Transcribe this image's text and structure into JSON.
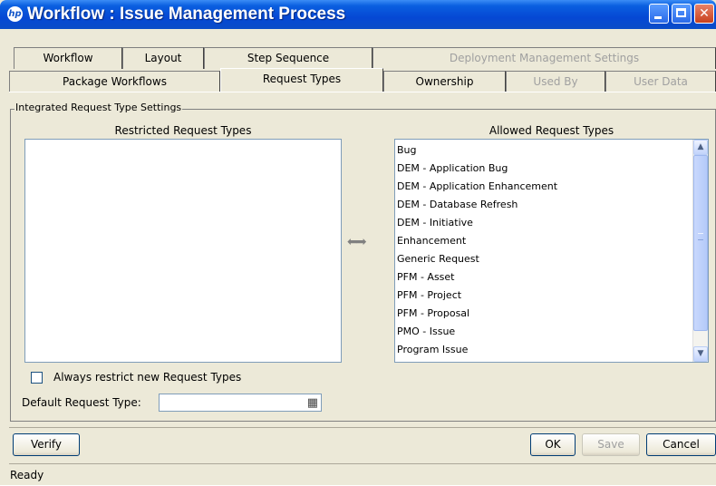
{
  "window": {
    "title": "Workflow : Issue Management Process",
    "logo": "hp"
  },
  "tabs": {
    "row1": [
      {
        "label": "Workflow",
        "enabled": true
      },
      {
        "label": "Layout",
        "enabled": true
      },
      {
        "label": "Step Sequence",
        "enabled": true
      },
      {
        "label": "Deployment Management Settings",
        "enabled": false
      }
    ],
    "row2": [
      {
        "label": "Package Workflows",
        "enabled": true
      },
      {
        "label": "Request Types",
        "enabled": true,
        "selected": true
      },
      {
        "label": "Ownership",
        "enabled": true
      },
      {
        "label": "Used By",
        "enabled": false
      },
      {
        "label": "User Data",
        "enabled": false
      }
    ]
  },
  "panel": {
    "group_label": "Integrated Request Type Settings",
    "restricted_title": "Restricted Request Types",
    "allowed_title": "Allowed Request Types",
    "allowed_items": [
      "Bug",
      "DEM - Application Bug",
      "DEM - Application Enhancement",
      "DEM - Database Refresh",
      "DEM - Initiative",
      "Enhancement",
      "Generic Request",
      "PFM - Asset",
      "PFM - Project",
      "PFM - Proposal",
      "PMO - Issue",
      "Program Issue"
    ],
    "always_restrict_label": "Always restrict new Request Types",
    "always_restrict_checked": false,
    "default_type_label": "Default Request Type:",
    "default_type_value": ""
  },
  "buttons": {
    "verify": "Verify",
    "ok": "OK",
    "save": "Save",
    "cancel": "Cancel"
  },
  "status": {
    "text": "Ready"
  },
  "colors": {
    "titlebar": "#0a5fe0",
    "window_bg": "#ece9d8",
    "close": "#c8401c"
  }
}
